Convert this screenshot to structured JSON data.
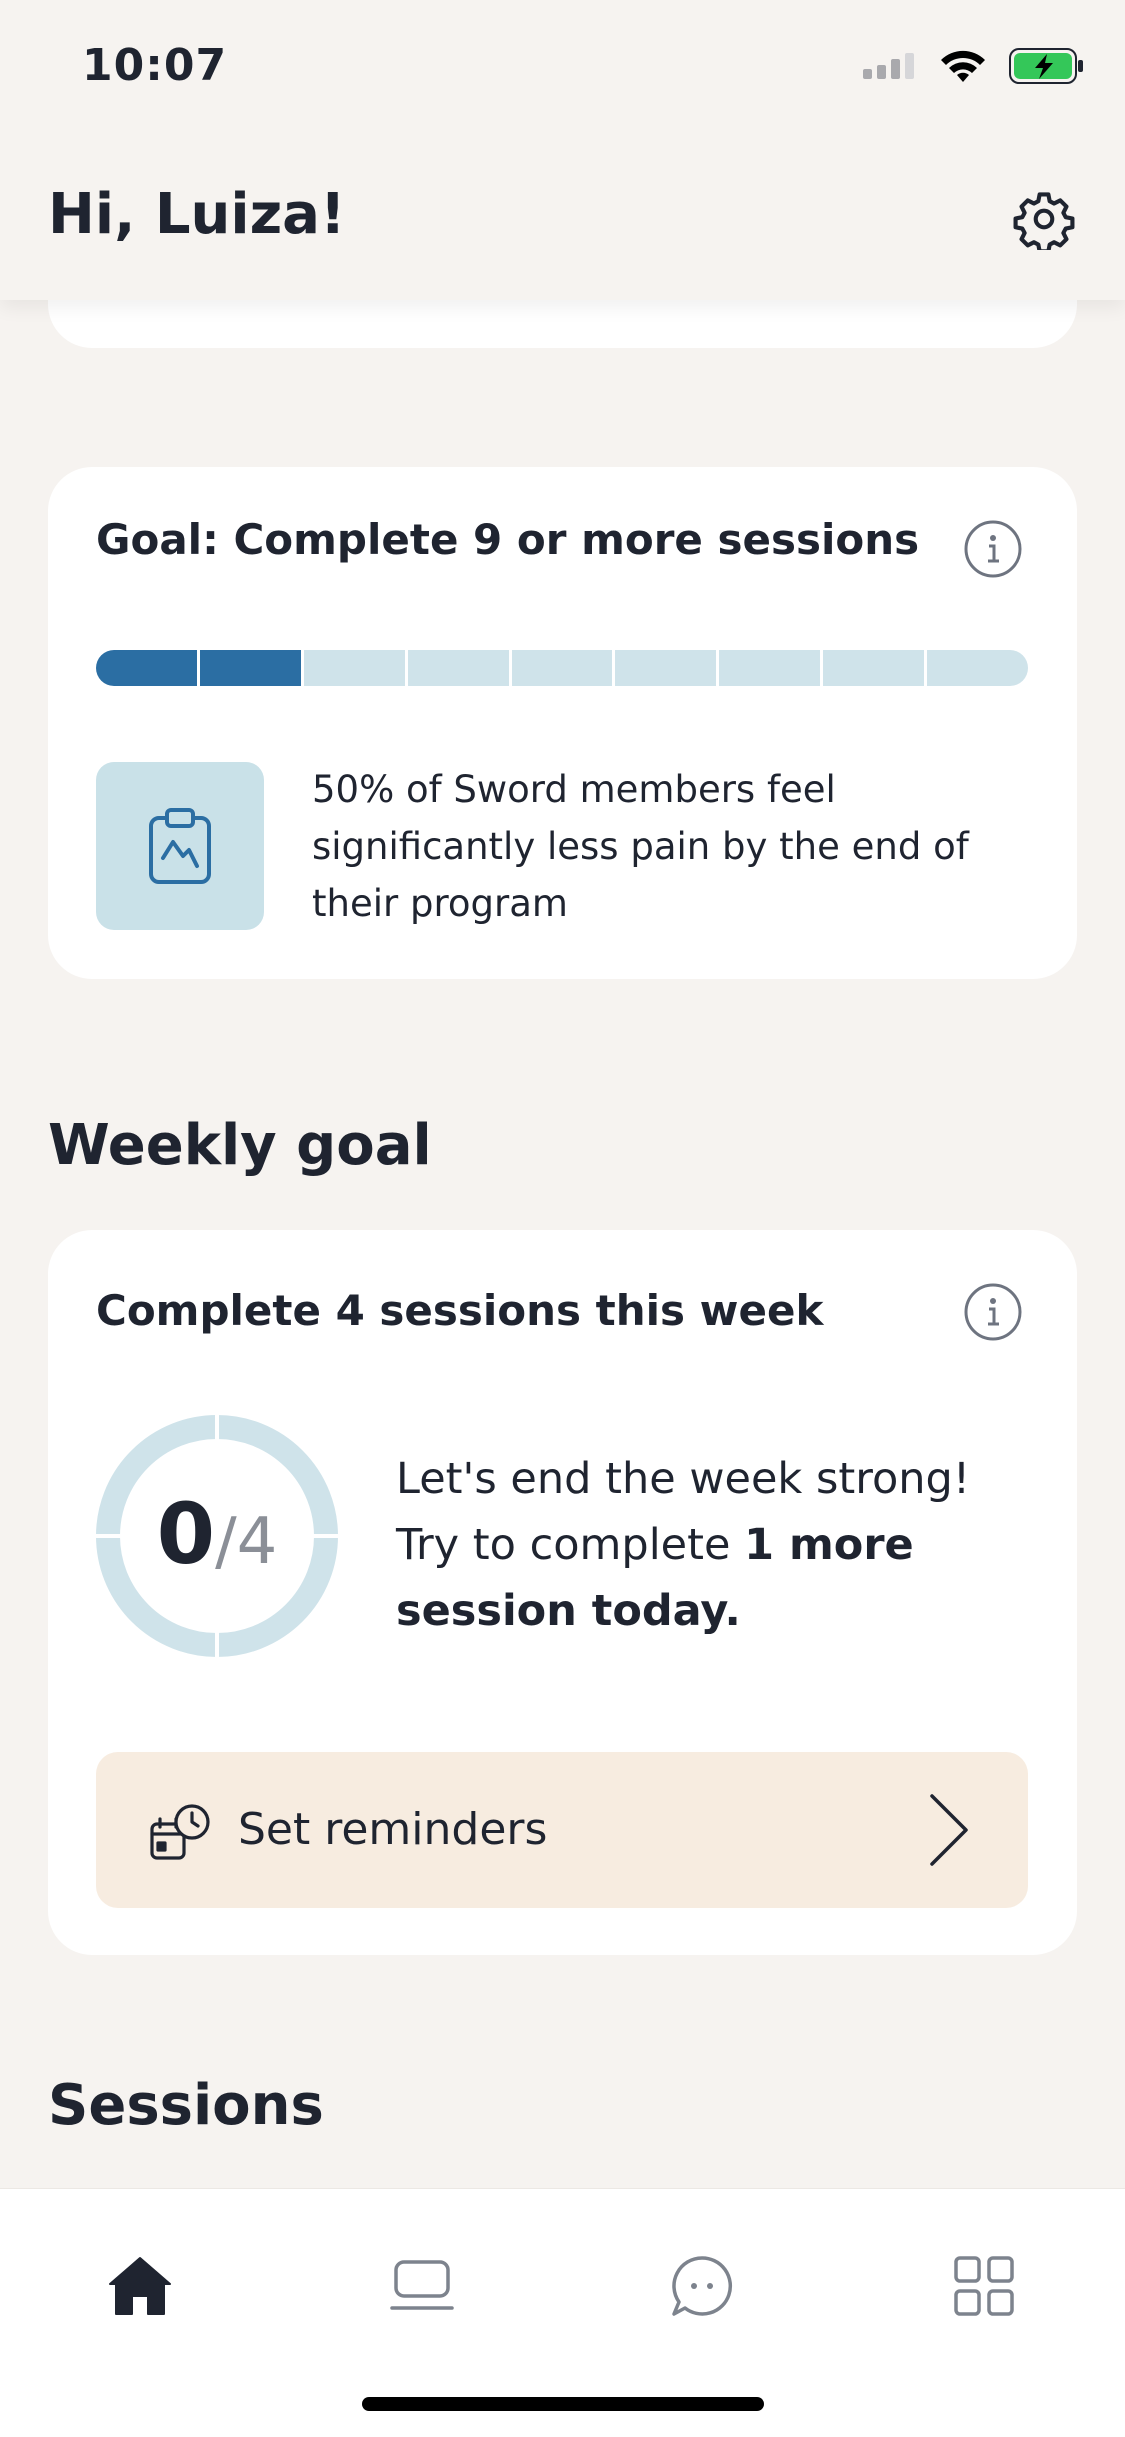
{
  "status_bar": {
    "time": "10:07"
  },
  "header": {
    "greeting": "Hi, Luiza!"
  },
  "program_goal": {
    "title": "Goal: Complete 9 or more sessions",
    "completed": 2,
    "total_segments": 9,
    "stat_text": "50% of Sword members feel significantly less pain by the end of their program"
  },
  "weekly": {
    "section_title": "Weekly goal",
    "title": "Complete 4 sessions this week",
    "count_done": "0",
    "count_total": "/4",
    "message_prefix": "Let's end the week strong! Try to complete ",
    "message_bold": "1 more session today.",
    "reminder_label": "Set reminders"
  },
  "sessions": {
    "section_title": "Sessions"
  },
  "tabs": [
    "home-icon",
    "sessions-icon",
    "chat-icon",
    "menu-grid-icon"
  ],
  "colors": {
    "accent": "#2b6ea3",
    "progress_track": "#cfe3ea",
    "reminder_bg": "#f7ece0",
    "background": "#f6f3f0"
  }
}
